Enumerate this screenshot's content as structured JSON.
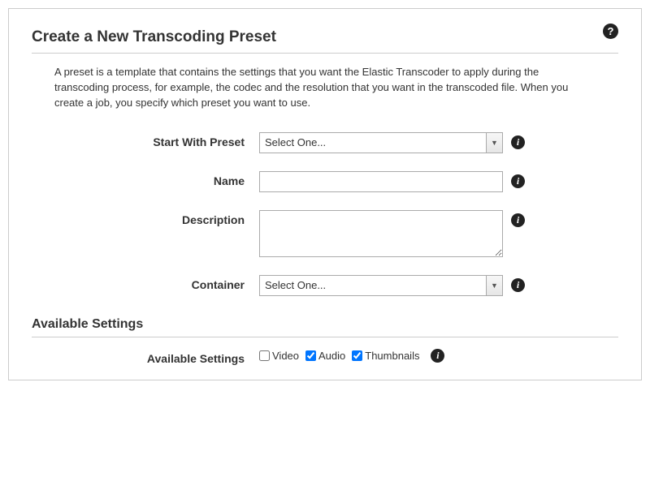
{
  "header": {
    "title": "Create a New Transcoding Preset"
  },
  "intro": "A preset is a template that contains the settings that you want the Elastic Transcoder to apply during the transcoding process, for example, the codec and the resolution that you want in the transcoded file. When you create a job, you specify which preset you want to use.",
  "form": {
    "start_with_preset": {
      "label": "Start With Preset",
      "selected": "Select One..."
    },
    "name": {
      "label": "Name",
      "value": ""
    },
    "description": {
      "label": "Description",
      "value": ""
    },
    "container": {
      "label": "Container",
      "selected": "Select One..."
    }
  },
  "available_settings": {
    "heading": "Available Settings",
    "label": "Available Settings",
    "options": {
      "video": {
        "label": "Video",
        "checked": false
      },
      "audio": {
        "label": "Audio",
        "checked": true
      },
      "thumbnails": {
        "label": "Thumbnails",
        "checked": true
      }
    }
  },
  "icons": {
    "info": "i",
    "help": "?"
  }
}
